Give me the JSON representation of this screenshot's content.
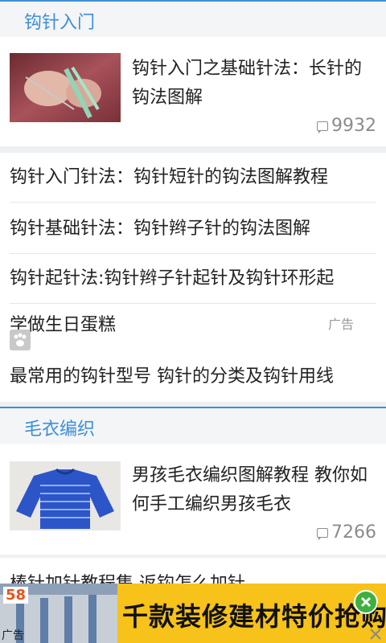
{
  "section1": {
    "title": "钩针入门",
    "featured": {
      "title": "钩针入门之基础针法：长针的钩法图解",
      "comments": "9932"
    },
    "list": [
      "钩针入门针法：钩针短针的钩法图解教程",
      "钩针基础针法：钩针辫子针的钩法图解",
      "钩针起针法:钩针辫子针起针及钩针环形起"
    ],
    "ad": {
      "title": "学做生日蛋糕",
      "tag": "广告"
    },
    "last_item": "最常用的钩针型号 钩针的分类及钩针用线"
  },
  "section2": {
    "title": "毛衣编织",
    "featured": {
      "title": "男孩毛衣编织图解教程 教你如何手工编织男孩毛衣",
      "comments": "7266"
    },
    "partial_item": "棒针加针教程集 返钩怎么加针"
  },
  "banner": {
    "logo": "58",
    "text": "千款装修建材特价抢购",
    "ad_label": "广告"
  },
  "colors": {
    "accent": "#3e8fd6",
    "banner_yellow": "#f7c21a"
  }
}
